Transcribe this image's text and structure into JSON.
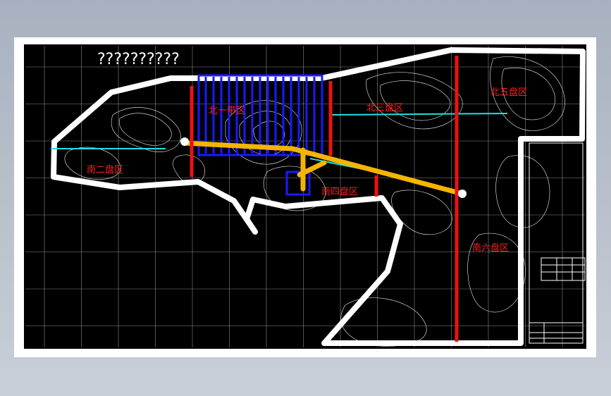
{
  "drawing": {
    "title": "??????????",
    "zones": {
      "north1": "北一带区",
      "north3": "北三盘区",
      "north5": "北五盘区",
      "south2": "南二盘区",
      "south4": "南四盘区",
      "south6": "南六盘区"
    }
  },
  "colors": {
    "background": "#000000",
    "boundary": "#ffffff",
    "main_roadway": "#f5b400",
    "panel_blue": "#1a1aff",
    "shaft_red": "#ee1111",
    "zone_label": "#ff2020",
    "contour": "#cfcfcf",
    "grid": "#9a9a9a",
    "cyan_line": "#22e0e0"
  }
}
